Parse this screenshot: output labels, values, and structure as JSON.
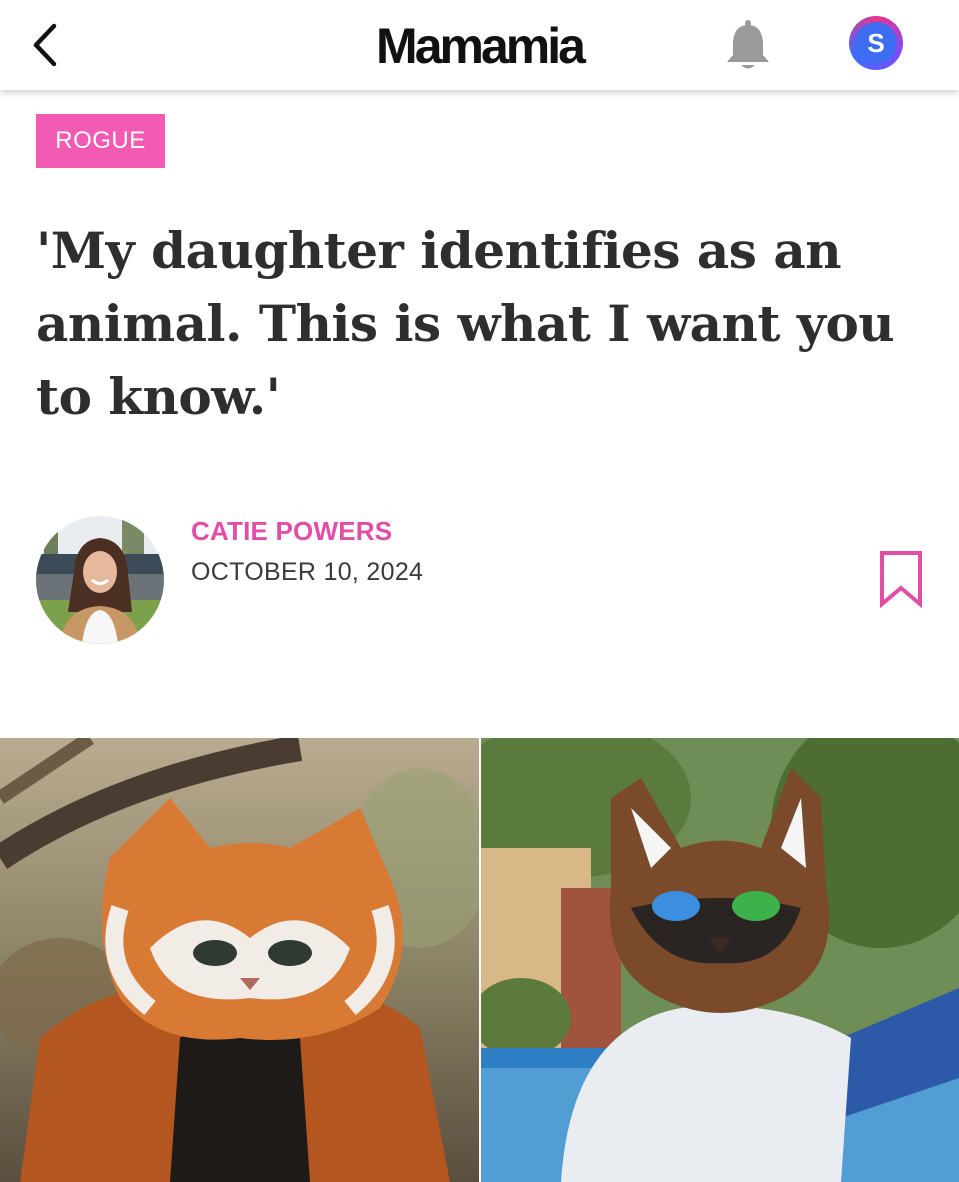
{
  "header": {
    "brand": "Mamamia",
    "back_icon": "chevron-left-icon",
    "notification_icon": "bell-icon",
    "profile_initial": "S"
  },
  "article": {
    "category": "ROGUE",
    "headline": "'My daughter identifies as an animal. This is what I want you to know.'",
    "author": "CATIE POWERS",
    "date": "OCTOBER 10, 2024",
    "bookmark_icon": "bookmark-icon"
  },
  "colors": {
    "accent_pink": "#f25ab3",
    "author_pink": "#e24ea7",
    "headline": "#2e2e2e",
    "profile_blue": "#3f6df2"
  }
}
